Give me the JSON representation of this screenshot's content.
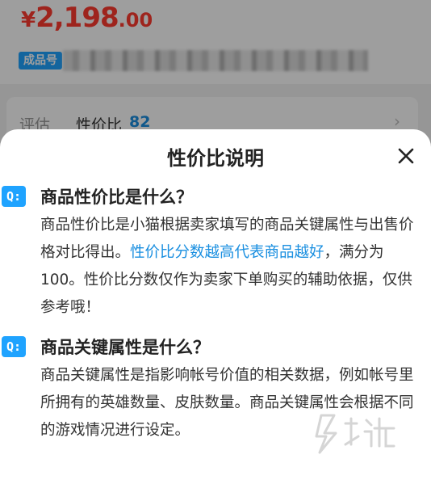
{
  "background": {
    "price": {
      "currency": "¥",
      "integer": "2,198",
      "decimal": ".00"
    },
    "sku_label": "成品号",
    "eval_label": "评估",
    "eval_key": "性价比",
    "eval_score": "82"
  },
  "sheet": {
    "title": "性价比说明",
    "q_icon": "Q:",
    "q1": {
      "title": "商品性价比是什么？",
      "body_before": "商品性价比是小猫根据卖家填写的商品关键属性与出售价格对比得出。",
      "body_highlight": "性价比分数越高代表商品越好",
      "body_after": "，满分为100。性价比分数仅作为卖家下单购买的辅助依据，仅供参考哦！"
    },
    "q2": {
      "title": "商品关键属性是什么？",
      "body": "商品关键属性是指影响帐号价值的相关数据，例如帐号里所拥有的英雄数量、皮肤数量。商品关键属性会根据不同的游戏情况进行设定。"
    }
  },
  "colors": {
    "price_red": "#ff3b30",
    "accent_blue": "#1fa3ff",
    "highlight_blue": "#1a8fe0"
  },
  "icons": {
    "close": "close-icon",
    "chevron": "chevron-right-icon",
    "question": "question-badge-icon"
  }
}
